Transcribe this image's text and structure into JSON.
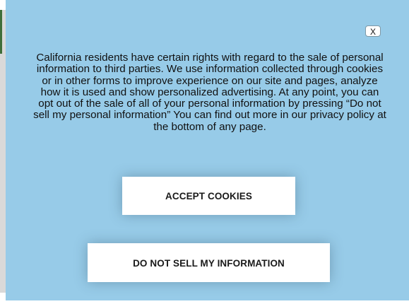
{
  "dialog": {
    "close_label": "X",
    "message": "California residents have certain rights with regard to the sale of personal information to third parties. We use information collected through cookies or in other forms to improve experience on our site and pages, analyze how it is used and show personalized advertising. At any point, you can opt out of the sale of all of your personal information by pressing “Do not sell my personal information” You can find out more in our privacy policy at the bottom of any page.",
    "accept_label": "ACCEPT COOKIES",
    "do_not_sell_label": "DO NOT SELL MY INFORMATION"
  },
  "colors": {
    "modal_background": "#97cbe8",
    "button_background": "#ffffff",
    "text": "#111111"
  }
}
